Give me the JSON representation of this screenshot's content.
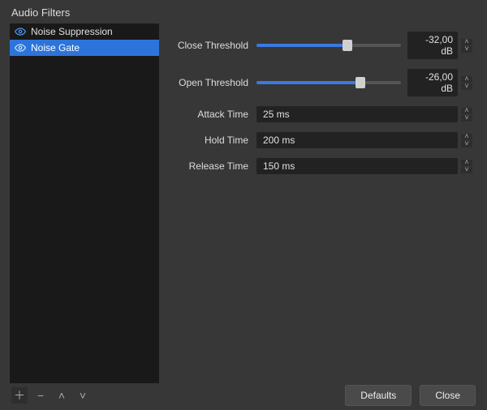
{
  "window": {
    "title": "Audio Filters"
  },
  "sidebar": {
    "items": [
      {
        "label": "Noise Suppression",
        "selected": false
      },
      {
        "label": "Noise Gate",
        "selected": true
      }
    ]
  },
  "settings": {
    "close_threshold": {
      "label": "Close Threshold",
      "value": "-32,00 dB",
      "percent": 63
    },
    "open_threshold": {
      "label": "Open Threshold",
      "value": "-26,00 dB",
      "percent": 72
    },
    "attack_time": {
      "label": "Attack Time",
      "value": "25 ms"
    },
    "hold_time": {
      "label": "Hold Time",
      "value": "200 ms"
    },
    "release_time": {
      "label": "Release Time",
      "value": "150 ms"
    }
  },
  "footer": {
    "defaults": "Defaults",
    "close": "Close"
  }
}
